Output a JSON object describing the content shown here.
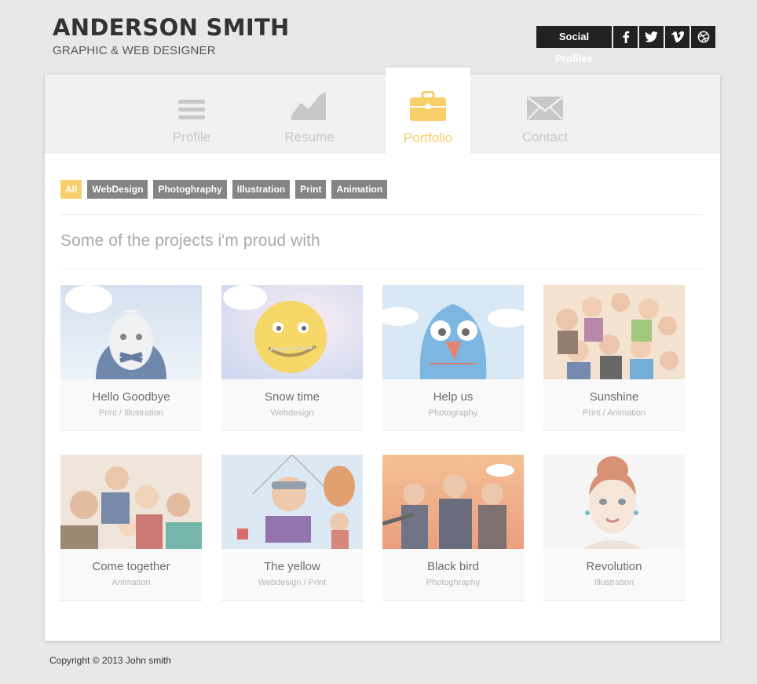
{
  "header": {
    "name": "ANDERSON SMITH",
    "tagline": "GRAPHIC & WEB DESIGNER"
  },
  "social": {
    "label": "Social Profiles",
    "icons": [
      "facebook-icon",
      "twitter-icon",
      "vimeo-icon",
      "dribbble-icon"
    ]
  },
  "tabs": [
    {
      "label": "Profile",
      "icon": "menu-lines-icon",
      "active": false
    },
    {
      "label": "Resume",
      "icon": "chart-area-icon",
      "active": false
    },
    {
      "label": "Portfolio",
      "icon": "briefcase-icon",
      "active": true
    },
    {
      "label": "Contact",
      "icon": "envelope-icon",
      "active": false
    }
  ],
  "filters": [
    {
      "label": "All",
      "active": true
    },
    {
      "label": "WebDesign",
      "active": false
    },
    {
      "label": "Photoghraphy",
      "active": false
    },
    {
      "label": "Illustration",
      "active": false
    },
    {
      "label": "Print",
      "active": false
    },
    {
      "label": "Animation",
      "active": false
    }
  ],
  "section_title": "Some of the projects i'm proud with",
  "projects": [
    {
      "title": "Hello Goodbye",
      "category": "Print / Illustration"
    },
    {
      "title": "Snow time",
      "category": "Webdesign"
    },
    {
      "title": "Help us",
      "category": "Photography"
    },
    {
      "title": "Sunshine",
      "category": "Print / Animation"
    },
    {
      "title": "Come together",
      "category": "Animation"
    },
    {
      "title": "The yellow",
      "category": "Webdesign / Print"
    },
    {
      "title": "Black bird",
      "category": "Photoghraphy"
    },
    {
      "title": "Revolution",
      "category": "Illustration"
    }
  ],
  "footer": {
    "copyright": "Copyright © 2013 John smith"
  },
  "colors": {
    "accent": "#f5bc30",
    "dark": "#222222",
    "tag": "#555555",
    "tab_inactive": "#b3b3b3"
  }
}
